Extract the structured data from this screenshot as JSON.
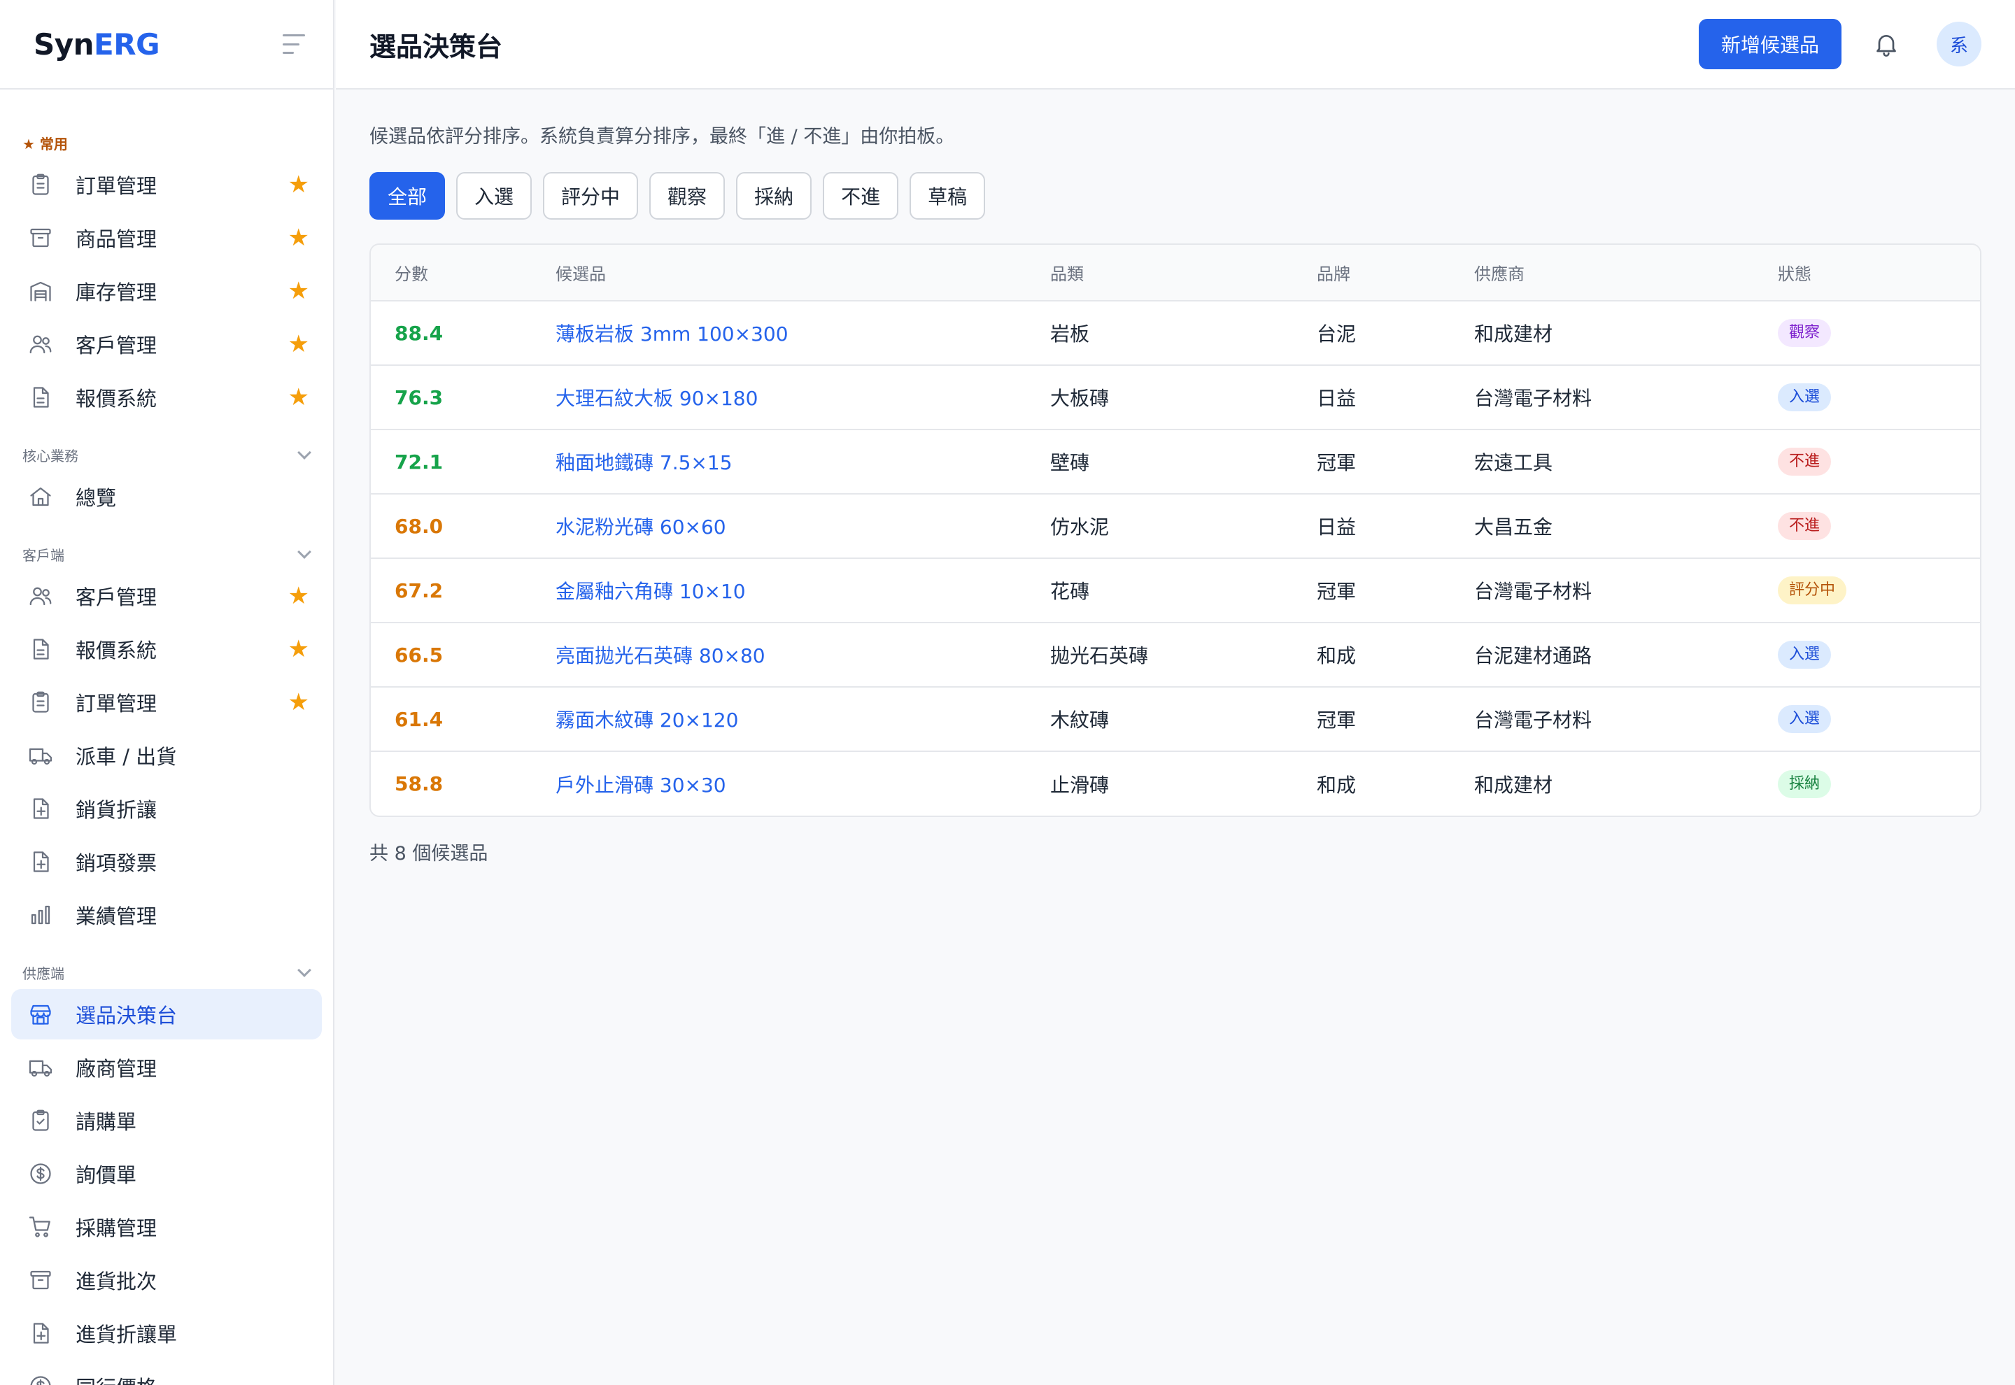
{
  "brand": {
    "syn": "Syn",
    "erg": "ERG"
  },
  "header": {
    "title": "選品決策台",
    "add_button": "新增候選品",
    "avatar": "系"
  },
  "sidebar": {
    "favorites": {
      "title": "★ 常用",
      "items": [
        {
          "label": "訂單管理",
          "icon": "clipboard-icon"
        },
        {
          "label": "商品管理",
          "icon": "archive-icon"
        },
        {
          "label": "庫存管理",
          "icon": "warehouse-icon"
        },
        {
          "label": "客戶管理",
          "icon": "users-icon"
        },
        {
          "label": "報價系統",
          "icon": "file-text-icon"
        }
      ]
    },
    "core": {
      "title": "核心業務",
      "items": [
        {
          "label": "總覽",
          "icon": "home-icon"
        }
      ]
    },
    "client": {
      "title": "客戶端",
      "items": [
        {
          "label": "客戶管理",
          "icon": "users-icon"
        },
        {
          "label": "報價系統",
          "icon": "file-text-icon"
        },
        {
          "label": "訂單管理",
          "icon": "clipboard-icon"
        },
        {
          "label": "派車 / 出貨",
          "icon": "truck-icon"
        },
        {
          "label": "銷貨折讓",
          "icon": "file-plus-icon"
        },
        {
          "label": "銷項發票",
          "icon": "file-plus-icon"
        },
        {
          "label": "業績管理",
          "icon": "bar-chart-icon"
        }
      ]
    },
    "supplier": {
      "title": "供應端",
      "items": [
        {
          "label": "選品決策台",
          "icon": "store-icon"
        },
        {
          "label": "廠商管理",
          "icon": "truck-icon"
        },
        {
          "label": "請購單",
          "icon": "clipboard-check-icon"
        },
        {
          "label": "詢價單",
          "icon": "dollar-circle-icon"
        },
        {
          "label": "採購管理",
          "icon": "cart-icon"
        },
        {
          "label": "進貨批次",
          "icon": "archive-icon"
        },
        {
          "label": "進貨折讓單",
          "icon": "file-plus-icon"
        },
        {
          "label": "同行價格",
          "icon": "dollar-circle-icon"
        }
      ]
    }
  },
  "main": {
    "description": "候選品依評分排序。系統負責算分排序，最終「進 / 不進」由你拍板。",
    "filters": [
      "全部",
      "入選",
      "評分中",
      "觀察",
      "採納",
      "不進",
      "草稿"
    ],
    "columns": [
      "分數",
      "候選品",
      "品類",
      "品牌",
      "供應商",
      "狀態"
    ],
    "rows": [
      {
        "score": "88.4",
        "name": "薄板岩板 3mm 100×300",
        "category": "岩板",
        "brand": "台泥",
        "supplier": "和成建材",
        "status": "觀察"
      },
      {
        "score": "76.3",
        "name": "大理石紋大板 90×180",
        "category": "大板磚",
        "brand": "日益",
        "supplier": "台灣電子材料",
        "status": "入選"
      },
      {
        "score": "72.1",
        "name": "釉面地鐵磚 7.5×15",
        "category": "壁磚",
        "brand": "冠軍",
        "supplier": "宏遠工具",
        "status": "不進"
      },
      {
        "score": "68.0",
        "name": "水泥粉光磚 60×60",
        "category": "仿水泥",
        "brand": "日益",
        "supplier": "大昌五金",
        "status": "不進"
      },
      {
        "score": "67.2",
        "name": "金屬釉六角磚 10×10",
        "category": "花磚",
        "brand": "冠軍",
        "supplier": "台灣電子材料",
        "status": "評分中"
      },
      {
        "score": "66.5",
        "name": "亮面拋光石英磚 80×80",
        "category": "拋光石英磚",
        "brand": "和成",
        "supplier": "台泥建材通路",
        "status": "入選"
      },
      {
        "score": "61.4",
        "name": "霧面木紋磚 20×120",
        "category": "木紋磚",
        "brand": "冠軍",
        "supplier": "台灣電子材料",
        "status": "入選"
      },
      {
        "score": "58.8",
        "name": "戶外止滑磚 30×30",
        "category": "止滑磚",
        "brand": "和成",
        "supplier": "和成建材",
        "status": "採納"
      }
    ],
    "total": "共 8 個候選品"
  },
  "colors": {
    "accent": "#2563eb",
    "score_high": "#16a34a",
    "score_mid": "#d97706",
    "star": "#f59e0b"
  }
}
